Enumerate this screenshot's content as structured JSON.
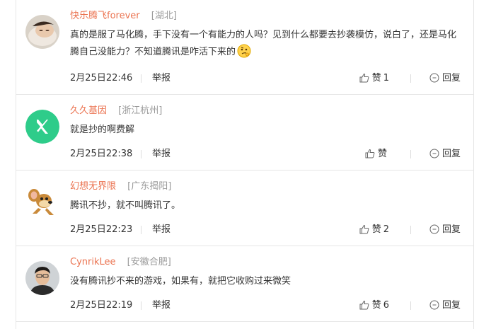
{
  "comments": [
    {
      "nickname": "快乐腾飞forever",
      "location": "[湖北]",
      "text": "真的是服了马化腾，手下没有一个有能力的人吗？见到什么都要去抄袭模仿，说白了，还是马化腾自己没能力？不知道腾讯是咋活下来的",
      "emoji": "thinking-emoji",
      "time": "2月25日22:46",
      "report_label": "举报",
      "like_label": "赞",
      "like_count": "1",
      "reply_label": "回复",
      "avatar": "photo-avatar"
    },
    {
      "nickname": "久久基因",
      "location": "[浙江杭州]",
      "text": "就是抄的啊费解",
      "time": "2月25日22:38",
      "report_label": "举报",
      "like_label": "赞",
      "like_count": "",
      "reply_label": "回复",
      "avatar": "green-logo-avatar"
    },
    {
      "nickname": "幻想无界限",
      "location": "[广东揭阳]",
      "text": "腾讯不抄，就不叫腾讯了。",
      "time": "2月25日22:23",
      "report_label": "举报",
      "like_label": "赞",
      "like_count": "2",
      "reply_label": "回复",
      "avatar": "cartoon-mouse-avatar"
    },
    {
      "nickname": "CynrikLee",
      "location": "[安徽合肥]",
      "text": "没有腾讯抄不来的游戏，如果有，就把它收购过来微笑",
      "time": "2月25日22:19",
      "report_label": "举报",
      "like_label": "赞",
      "like_count": "6",
      "reply_label": "回复",
      "avatar": "person-avatar"
    }
  ],
  "colors": {
    "nickname": "#eb7350",
    "location": "#999999",
    "text": "#333333",
    "divider": "#e6e6e6",
    "logo_green": "#2ecc8a"
  }
}
